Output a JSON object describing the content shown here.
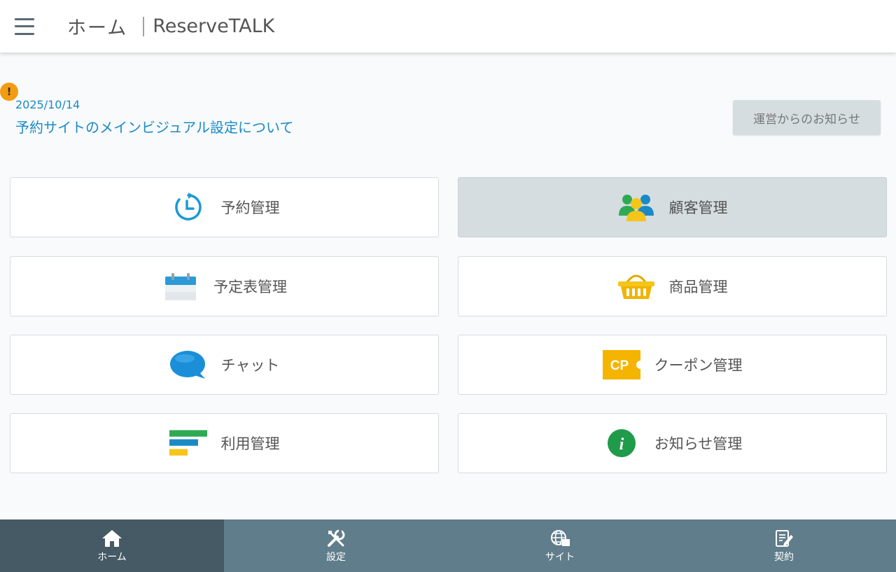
{
  "header": {
    "page_title": "ホーム",
    "app_title": "ReserveTALK",
    "menu_icon": "hamburger-menu-icon"
  },
  "notice": {
    "alert_mark": "!",
    "date": "2025/10/14",
    "title": "予約サイトのメインビジュアル設定について",
    "button_label": "運営からのお知らせ"
  },
  "tiles": [
    {
      "label": "予約管理",
      "icon": "clock-icon"
    },
    {
      "label": "顧客管理",
      "icon": "users-icon",
      "active": true
    },
    {
      "label": "予定表管理",
      "icon": "calendar-icon"
    },
    {
      "label": "商品管理",
      "icon": "basket-icon"
    },
    {
      "label": "チャット",
      "icon": "chat-bubble-icon"
    },
    {
      "label": "クーポン管理",
      "icon": "coupon-icon",
      "icon_text": "CP"
    },
    {
      "label": "利用管理",
      "icon": "usage-bars-icon"
    },
    {
      "label": "お知らせ管理",
      "icon": "info-icon",
      "icon_text": "i"
    }
  ],
  "bottom_nav": [
    {
      "label": "ホーム",
      "icon": "home-icon",
      "active": true
    },
    {
      "label": "設定",
      "icon": "tools-icon"
    },
    {
      "label": "サイト",
      "icon": "globe-icon"
    },
    {
      "label": "契約",
      "icon": "contract-edit-icon"
    }
  ],
  "colors": {
    "accent": "#1a8ac6",
    "nav_bg": "#607d8b",
    "nav_active": "#455a64",
    "alert": "#f39c12"
  }
}
